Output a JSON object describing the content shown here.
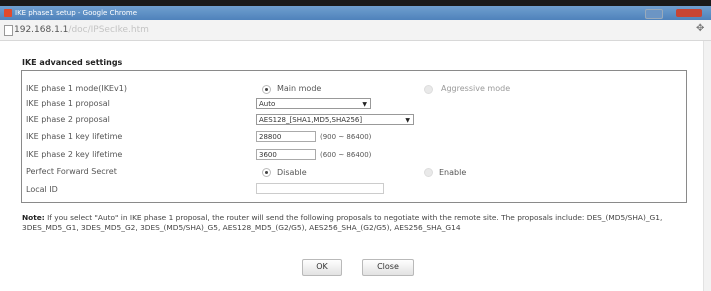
{
  "window": {
    "title": "IKE phase1 setup - Google Chrome",
    "colors": {
      "titlebar": "#5b8fc6",
      "close": "#c74535"
    }
  },
  "address": {
    "host": "192.168.1.1",
    "rest": "/doc/IPSecIke.htm"
  },
  "section_title": "IKE advanced settings",
  "form": {
    "phase1_mode": {
      "label": "IKE phase 1 mode(IKEv1)",
      "options": [
        "Main mode",
        "Aggressive mode"
      ],
      "selected": "Main mode"
    },
    "phase1_proposal": {
      "label": "IKE phase 1 proposal",
      "value": "Auto"
    },
    "phase2_proposal": {
      "label": "IKE phase 2 proposal",
      "value": "AES128_[SHA1,MD5,SHA256]"
    },
    "phase1_lifetime": {
      "label": "IKE phase 1 key lifetime",
      "value": "28800",
      "range": "(900 ~ 86400)"
    },
    "phase2_lifetime": {
      "label": "IKE phase 2 key lifetime",
      "value": "3600",
      "range": "(600 ~ 86400)"
    },
    "pfs": {
      "label": "Perfect Forward Secret",
      "options": [
        "Disable",
        "Enable"
      ],
      "selected": "Disable"
    },
    "local_id": {
      "label": "Local ID",
      "value": ""
    }
  },
  "note": {
    "prefix": "Note:",
    "text": "If you select \"Auto\" in IKE phase 1 proposal, the router will send the following proposals to negotiate with the remote site. The proposals include: DES_(MD5/SHA)_G1, 3DES_MD5_G1, 3DES_MD5_G2, 3DES_(MD5/SHA)_G5, AES128_MD5_(G2/G5), AES256_SHA_(G2/G5), AES256_SHA_G14"
  },
  "buttons": {
    "ok": "OK",
    "close": "Close"
  }
}
